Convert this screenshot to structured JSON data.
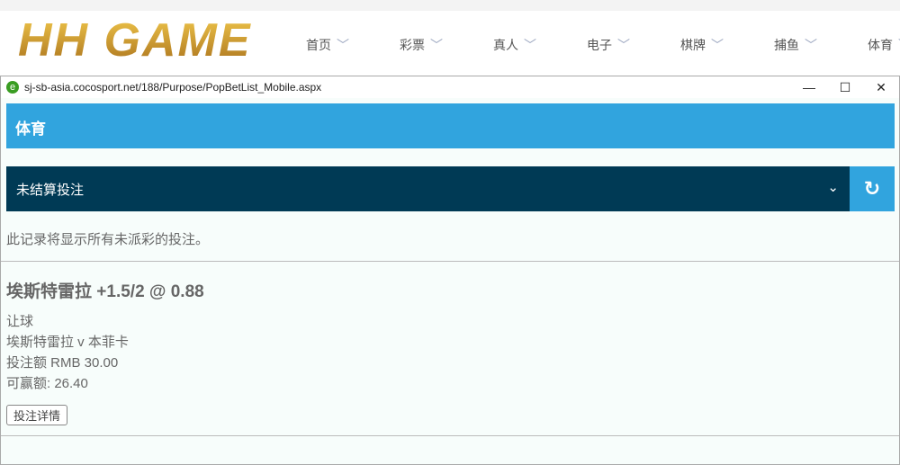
{
  "site": {
    "logo": "HH GAME",
    "nav": [
      "首页",
      "彩票",
      "真人",
      "电子",
      "棋牌",
      "捕鱼",
      "体育"
    ]
  },
  "popup": {
    "url": "sj-sb-asia.cocosport.net/188/Purpose/PopBetList_Mobile.aspx",
    "header": "体育",
    "select": "未结算投注",
    "note": "此记录将显示所有未派彩的投注。",
    "bet": {
      "title": "埃斯特雷拉 +1.5/2 @ 0.88",
      "type": "让球",
      "match": "埃斯特雷拉 v 本菲卡",
      "stake": "投注额 RMB 30.00",
      "win": "可赢额: 26.40",
      "details": "投注详情"
    }
  }
}
